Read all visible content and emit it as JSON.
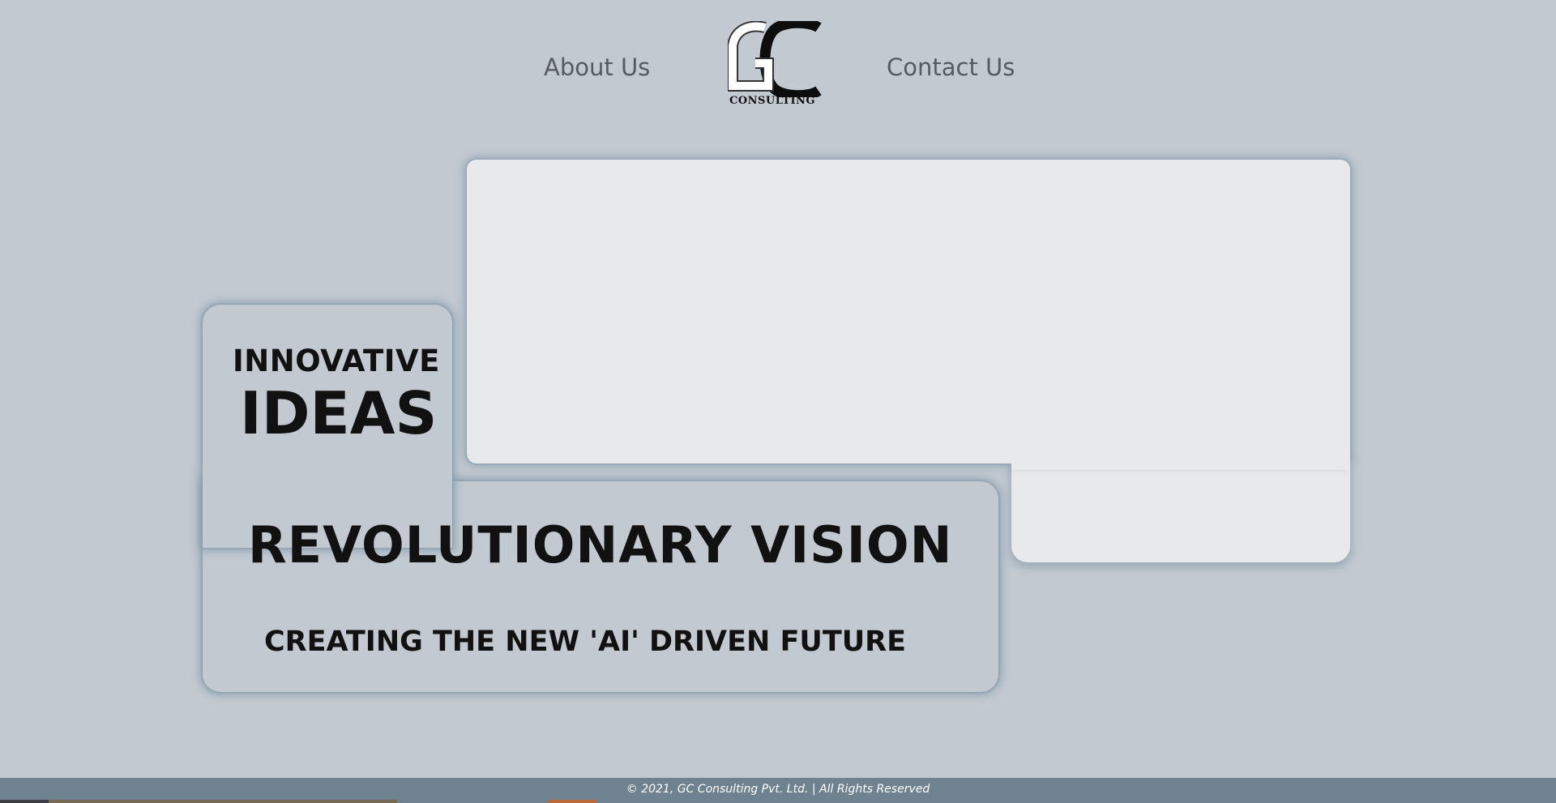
{
  "nav": {
    "about_label": "About Us",
    "contact_label": "Contact Us"
  },
  "logo": {
    "letters": "GC",
    "caption": "CONSULTING"
  },
  "hero": {
    "innovative": "INNOVATIVE",
    "ideas": "IDEAS",
    "vision": "REVOLUTIONARY VISION",
    "tagline": "CREATING THE NEW 'AI' DRIVEN FUTURE"
  },
  "footer": {
    "text": "© 2021, GC Consulting Pvt. Ltd. | All Rights Reserved"
  },
  "colors": {
    "background": "#c2c9d1",
    "panel_light": "#e8e9eb",
    "footer_bg": "#6f8290",
    "nav_text": "#555b60"
  }
}
